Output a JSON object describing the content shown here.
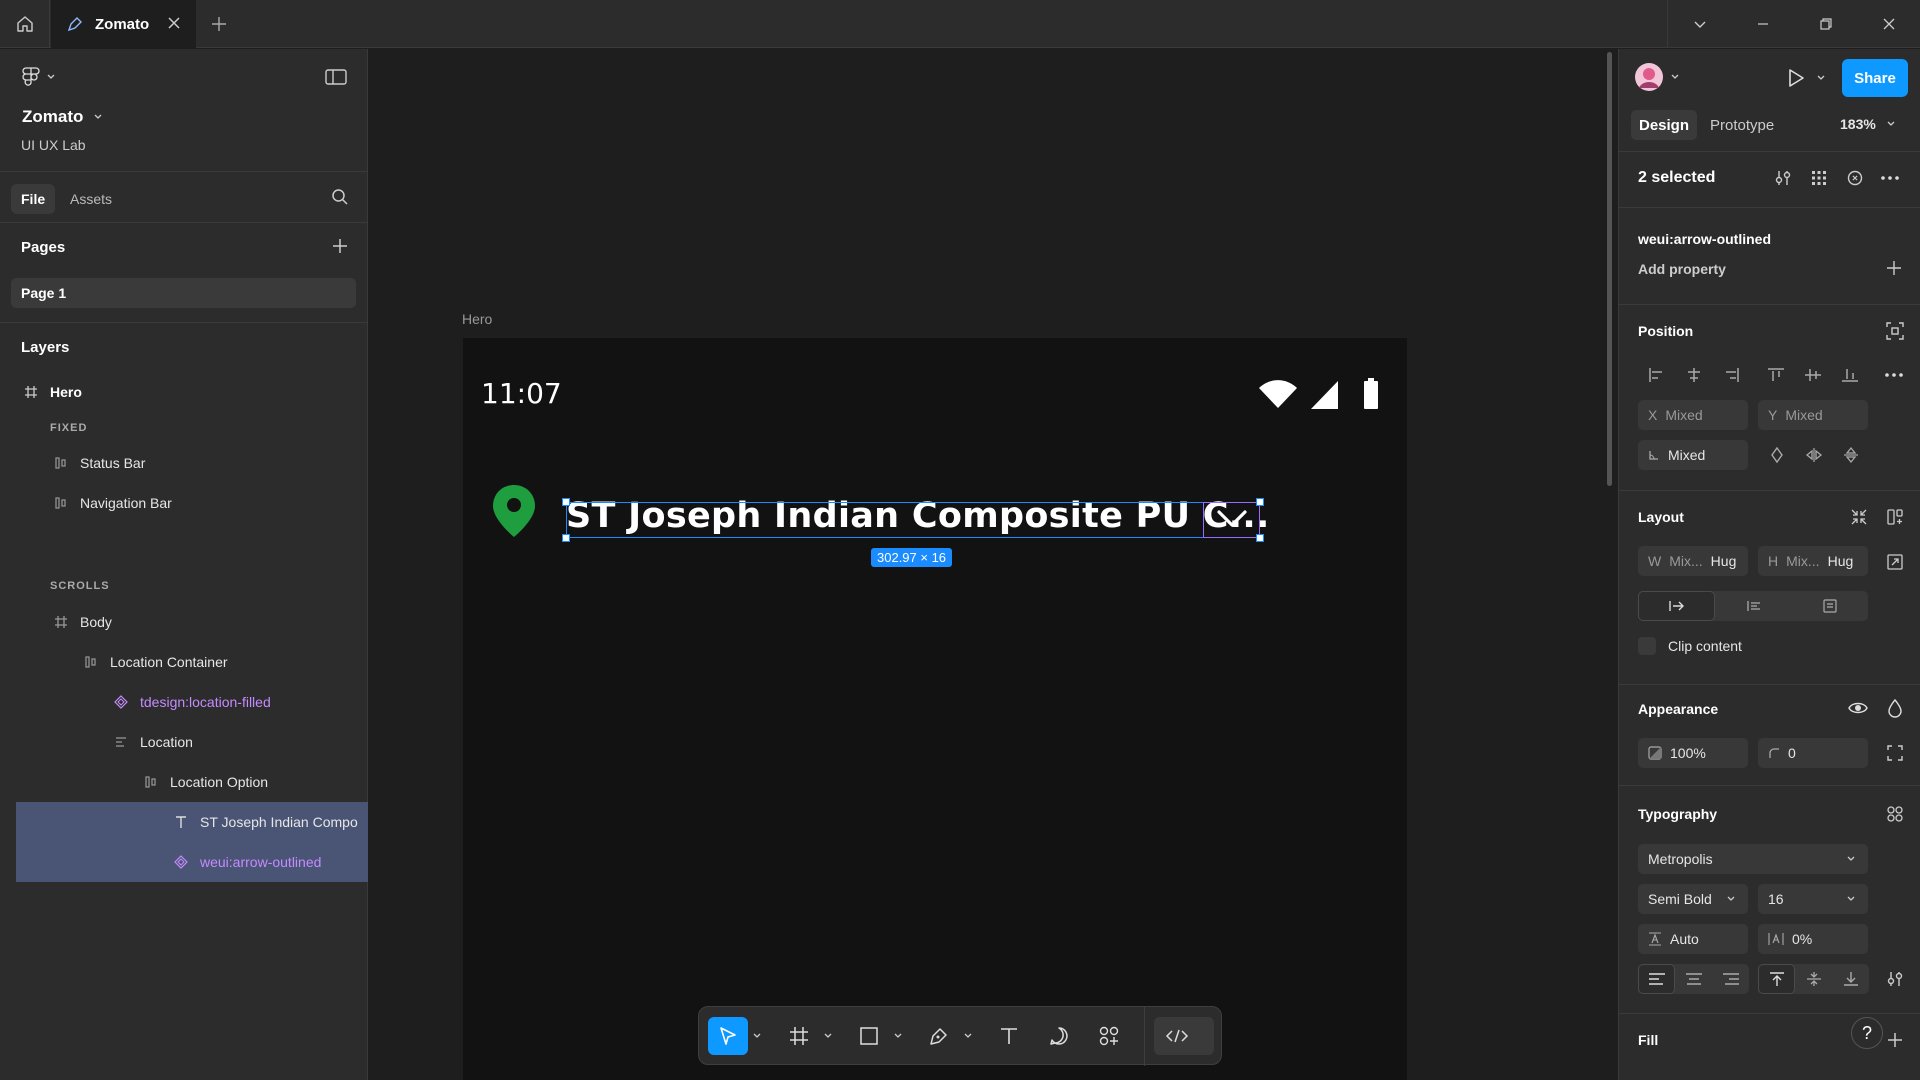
{
  "titlebar": {
    "tab_title": "Zomato"
  },
  "left": {
    "file_name": "Zomato",
    "team": "UI UX Lab",
    "tabs": [
      "File",
      "Assets"
    ],
    "pages_header": "Pages",
    "pages": [
      "Page 1"
    ],
    "layers_header": "Layers",
    "layers": [
      {
        "label": "Hero",
        "icon": "frame-icon"
      },
      {
        "label": "FIXED",
        "icon": ""
      },
      {
        "label": "Status Bar",
        "icon": "autolayout-icon"
      },
      {
        "label": "Navigation Bar",
        "icon": "autolayout-icon"
      },
      {
        "label": "SCROLLS",
        "icon": ""
      },
      {
        "label": "Body",
        "icon": "frame-icon"
      },
      {
        "label": "Location Container",
        "icon": "autolayout-icon"
      },
      {
        "label": "tdesign:location-filled",
        "icon": "component-icon"
      },
      {
        "label": "Location",
        "icon": "text-icon"
      },
      {
        "label": "Location Option",
        "icon": "autolayout-icon"
      },
      {
        "label": "ST Joseph Indian Compo",
        "icon": "text-icon"
      },
      {
        "label": "weui:arrow-outlined",
        "icon": "component-icon"
      }
    ]
  },
  "canvas": {
    "frame_label": "Hero",
    "time": "11:07",
    "location_text": "ST Joseph Indian Composite PU C...",
    "dimension_label": "302.97 × 16"
  },
  "right": {
    "share_label": "Share",
    "tabs": [
      "Design",
      "Prototype"
    ],
    "zoom": "183%",
    "selection": "2 selected",
    "component_name": "weui:arrow-outlined",
    "add_property": "Add property",
    "position_header": "Position",
    "x_label": "X",
    "x_value": "Mixed",
    "y_label": "Y",
    "y_value": "Mixed",
    "rotation_value": "Mixed",
    "layout_header": "Layout",
    "w_label": "W",
    "w_value": "Mix...",
    "w_mode": "Hug",
    "h_label": "H",
    "h_value": "Mix...",
    "h_mode": "Hug",
    "clip_content": "Clip content",
    "appearance_header": "Appearance",
    "opacity": "100%",
    "radius": "0",
    "typography_header": "Typography",
    "font_family": "Metropolis",
    "font_weight": "Semi Bold",
    "font_size": "16",
    "line_height": "Auto",
    "letter_spacing": "0%",
    "fill_header": "Fill",
    "help": "?"
  },
  "colors": {
    "accent": "#0d99ff",
    "selection_blue": "#1a8cff",
    "component_purple": "#c48bff",
    "pin_green": "#1e9e3f"
  }
}
